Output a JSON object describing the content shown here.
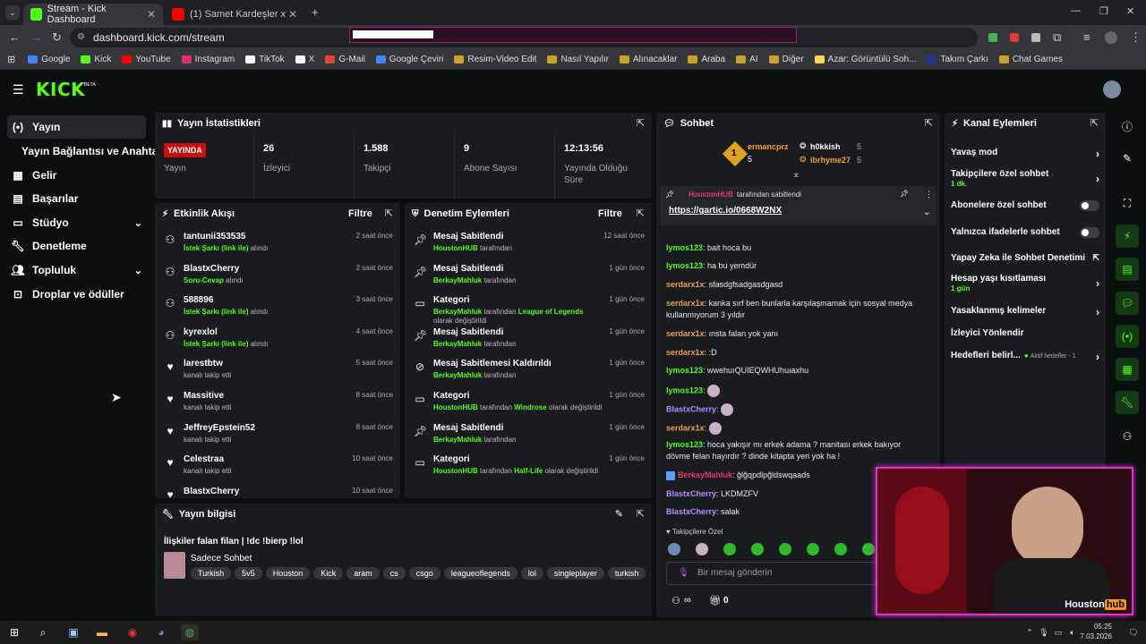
{
  "browser": {
    "tabs": [
      {
        "title": "Stream - Kick Dashboard"
      },
      {
        "title": "(1) Samet Kardeşler x Sıla Şahin"
      }
    ],
    "url": "dashboard.kick.com/stream",
    "bookmarks": [
      "Google",
      "Kick",
      "YouTube",
      "Instagram",
      "TikTok",
      "X",
      "G-Mail",
      "Google Çeviri",
      "Resim-Video Edit",
      "Nasıl Yapılır",
      "Alınacaklar",
      "Araba",
      "AI",
      "Diğer",
      "Azar: Görüntülü Soh...",
      "Takım Çarkı",
      "Chat Games"
    ]
  },
  "app": {
    "logo": "KICK",
    "beta": "BETA"
  },
  "sidebar": {
    "items": [
      {
        "label": "Yayın",
        "icon": "broadcast-icon"
      },
      {
        "label": "Yayın Bağlantısı ve Anahtarı",
        "icon": ""
      },
      {
        "label": "Gelir",
        "icon": "revenue-icon"
      },
      {
        "label": "Başarılar",
        "icon": "achievements-icon"
      },
      {
        "label": "Stüdyo",
        "icon": "studio-icon"
      },
      {
        "label": "Denetleme",
        "icon": "wrench-icon"
      },
      {
        "label": "Topluluk",
        "icon": "community-icon"
      },
      {
        "label": "Droplar ve ödüller",
        "icon": "drops-icon"
      }
    ]
  },
  "stats": {
    "title": "Yayın İstatistikleri",
    "live_badge": "YAYINDA",
    "cells": [
      {
        "value": "",
        "label": "Yayın"
      },
      {
        "value": "26",
        "label": "İzleyici"
      },
      {
        "value": "1.588",
        "label": "Takipçi"
      },
      {
        "value": "9",
        "label": "Abone Sayısı"
      },
      {
        "value": "12:13:56",
        "label": "Yayında Olduğu Süre"
      }
    ]
  },
  "activity": {
    "title": "Etkinlik Akışı",
    "filter": "Filtre",
    "rows": [
      {
        "user": "tantunii353535",
        "em": "İstek Şarkı (link ile)",
        "rest": "alındı",
        "time": "2 saat önce"
      },
      {
        "user": "BlastxCherry",
        "em": "Soru-Cevap",
        "rest": "alındı",
        "time": "2 saat önce"
      },
      {
        "user": "588896",
        "em": "İstek Şarkı (link ile)",
        "rest": "alındı",
        "time": "3 saat önce"
      },
      {
        "user": "kyrexlol",
        "em": "İstek Şarkı (link ile)",
        "rest": "alındı",
        "time": "4 saat önce"
      },
      {
        "user": "larestbtw",
        "em": "",
        "rest": "kanalı takip etti",
        "time": "5 saat önce"
      },
      {
        "user": "Massitive",
        "em": "",
        "rest": "kanalı takip etti",
        "time": "8 saat önce"
      },
      {
        "user": "JeffreyEpstein52",
        "em": "",
        "rest": "kanalı takip etti",
        "time": "8 saat önce"
      },
      {
        "user": "Celestraa",
        "em": "",
        "rest": "kanalı takip etti",
        "time": "10 saat önce"
      },
      {
        "user": "BlastxCherry",
        "em": "",
        "rest": "",
        "time": "10 saat önce"
      }
    ]
  },
  "moderation": {
    "title": "Denetim Eylemleri",
    "filter": "Filtre",
    "rows": [
      {
        "action": "Mesaj Sabitlendi",
        "who": "HoustonHUB",
        "mid": "tarafından",
        "em": "",
        "tail": "",
        "time": "12 saat önce"
      },
      {
        "action": "Mesaj Sabitlendi",
        "who": "BerkayMahluk",
        "mid": "tarafından",
        "em": "",
        "tail": "",
        "time": "1 gün önce"
      },
      {
        "action": "Kategori",
        "who": "BerkayMahluk",
        "mid": "tarafından",
        "em": "League of Legends",
        "tail": "olarak değiştirildi",
        "time": "1 gün önce"
      },
      {
        "action": "Mesaj Sabitlendi",
        "who": "BerkayMahluk",
        "mid": "tarafından",
        "em": "",
        "tail": "",
        "time": "1 gün önce"
      },
      {
        "action": "Mesaj Sabitlemesi Kaldırıldı",
        "who": "BerkayMahluk",
        "mid": "tarafından",
        "em": "",
        "tail": "",
        "time": "1 gün önce"
      },
      {
        "action": "Kategori",
        "who": "HoustonHUB",
        "mid": "tarafından",
        "em": "Windrose",
        "tail": "olarak değiştirildi",
        "time": "1 gün önce"
      },
      {
        "action": "Mesaj Sabitlendi",
        "who": "BerkayMahluk",
        "mid": "tarafından",
        "em": "",
        "tail": "",
        "time": "1 gün önce"
      },
      {
        "action": "Kategori",
        "who": "HoustonHUB",
        "mid": "tarafından",
        "em": "Half-Life",
        "tail": "olarak değiştirildi",
        "time": "1 gün önce"
      }
    ]
  },
  "streaminfo": {
    "title": "Yayın bilgisi",
    "stream_title": "İlişkiler falan filan | !dc !bierp !lol",
    "category": "Sadece Sohbet",
    "tags": [
      "Turkish",
      "5v5",
      "Houston",
      "Kick",
      "aram",
      "cs",
      "csgo",
      "leagueoflegends",
      "lol",
      "singleplayer",
      "turkish"
    ]
  },
  "chat": {
    "title": "Sohbet",
    "leaders": [
      {
        "name": "ermancprz",
        "count": "5"
      },
      {
        "name": "h0kkish",
        "count": "5"
      },
      {
        "name": "ibrhyme27",
        "count": "5"
      }
    ],
    "leader_rank": "1",
    "pinned_by": "HoustonHUB",
    "pinned_suffix": "tarafından sabitlendi",
    "pinned_link": "https://gartic.io/0668W2NX",
    "messages": [
      {
        "user": "lymos123",
        "text": "bait hoca bu"
      },
      {
        "user": "lymos123",
        "text": "ha bu yemdür"
      },
      {
        "user": "serdarx1x",
        "text": "sfasdgfsadgasdgasd"
      },
      {
        "user": "serdarx1x",
        "text": "kanka sırf ben bunlarla karşılaşmamak için sosyal medya"
      },
      {
        "user": "",
        "text": "kullanmıyorum 3 yıldır"
      },
      {
        "user": "serdarx1x",
        "text": "ınsta falan yok yanı"
      },
      {
        "user": "serdarx1x",
        "text": ":D"
      },
      {
        "user": "lymos123",
        "text": "wwehuıQUIEQWHUhuıaxhu"
      },
      {
        "user": "lymos123",
        "text": ""
      },
      {
        "user": "BlastxCherry",
        "text": ""
      },
      {
        "user": "serdarx1x",
        "text": ""
      },
      {
        "user": "lymos123",
        "text": "hoca yakışır mı erkek adama ? manitası erkek bakıyor"
      },
      {
        "user": "",
        "text": "dövme felan hayırdır ? dinde kitapta yeri yok ha !"
      },
      {
        "user": "BerkayMahluk",
        "text": "ğlğqpdlpğldswqaads"
      },
      {
        "user": "BlastxCherry",
        "text": "LKDMZFV"
      },
      {
        "user": "BlastxCherry",
        "text": "salak"
      }
    ],
    "followers_only": "Takipçilere Özel",
    "input_placeholder": "Bir mesaj gönderin",
    "points": "∞",
    "gift_count": "0"
  },
  "channel_actions": {
    "title": "Kanal Eylemleri",
    "rows": [
      {
        "label": "Yavaş mod",
        "sub": "",
        "control": "chevron"
      },
      {
        "label": "Takipçilere özel sohbet",
        "sub": "1 dk.",
        "control": "chevron"
      },
      {
        "label": "Abonelere özel sohbet",
        "sub": "",
        "control": "toggle"
      },
      {
        "label": "Yalnızca ifadelerle sohbet",
        "sub": "",
        "control": "toggle"
      },
      {
        "label": "Yapay Zeka ile Sohbet Denetimi",
        "sub": "",
        "control": "external"
      },
      {
        "label": "Hesap yaşı kısıtlaması",
        "sub": "1 gün",
        "control": "chevron"
      },
      {
        "label": "Yasaklanmış kelimeler",
        "sub": "",
        "control": "chevron"
      },
      {
        "label": "İzleyici Yönlendir",
        "sub": "",
        "control": "none"
      },
      {
        "label": "Hedefleri belirl...",
        "sub": "",
        "control": "chevron",
        "badge": "Aktif hedefler - 1"
      }
    ]
  },
  "webcam": {
    "brand1": "Houston",
    "brand2": "hub"
  },
  "taskbar": {
    "time": "05:25",
    "date": "7.03.2026"
  },
  "colors": {
    "kick_green": "#53fc18",
    "live_red": "#c81010",
    "panel": "#191b1f",
    "bg": "#0b0e0f"
  }
}
